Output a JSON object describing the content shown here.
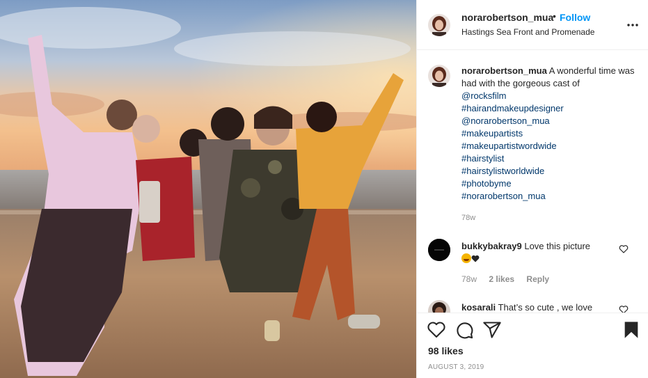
{
  "post": {
    "username": "norarobertson_mua",
    "dot": "•",
    "follow_label": "Follow",
    "location": "Hastings Sea Front and Promenade"
  },
  "caption": {
    "username": "norarobertson_mua",
    "text": " A wonderful time was had with the gorgeous cast of",
    "links": [
      "@rocksfilm",
      "#hairandmakeupdesigner",
      "@norarobertson_mua",
      "#makeupartists",
      "#makeupartistwordwide",
      "#hairstylist",
      "#hairstylistworldwide",
      "#photobyme",
      "#norarobertson_mua"
    ],
    "time": "78w"
  },
  "comments": [
    {
      "username": "bukkybakray9",
      "text": " Love this picture",
      "time": "78w",
      "likes": "2 likes",
      "reply": "Reply"
    },
    {
      "username": "kosarali",
      "text": "   That’s so cute , we love"
    }
  ],
  "footer": {
    "likes": "98 likes",
    "date": "AUGUST 3, 2019"
  },
  "colors": {
    "accent": "#0095f6",
    "text": "#262626",
    "muted": "#8e8e8e",
    "link": "#00376b"
  },
  "icons": [
    "more-icon",
    "heart-icon",
    "comment-icon",
    "share-icon",
    "bookmark-icon"
  ]
}
